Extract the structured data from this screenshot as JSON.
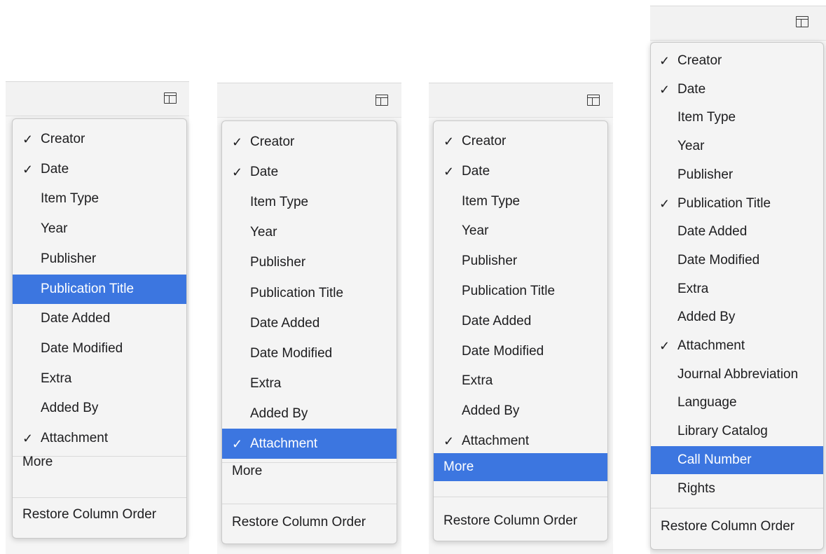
{
  "check_mark": "✓",
  "colors": {
    "highlight": "#3c76e0",
    "menu_bg": "#f4f4f4",
    "header_bg": "#f2f2f2"
  },
  "icons": {
    "column_picker": "column-picker-icon"
  },
  "menus": [
    {
      "items": [
        {
          "label": "Creator",
          "checked": true
        },
        {
          "label": "Date",
          "checked": true
        },
        {
          "label": "Item Type",
          "checked": false
        },
        {
          "label": "Year",
          "checked": false
        },
        {
          "label": "Publisher",
          "checked": false
        },
        {
          "label": "Publication Title",
          "checked": false,
          "highlighted": true
        },
        {
          "label": "Date Added",
          "checked": false
        },
        {
          "label": "Date Modified",
          "checked": false
        },
        {
          "label": "Extra",
          "checked": false
        },
        {
          "label": "Added By",
          "checked": false
        },
        {
          "label": "Attachment",
          "checked": true
        }
      ],
      "more_label": "More",
      "restore_label": "Restore Column Order"
    },
    {
      "items": [
        {
          "label": "Creator",
          "checked": true
        },
        {
          "label": "Date",
          "checked": true
        },
        {
          "label": "Item Type",
          "checked": false
        },
        {
          "label": "Year",
          "checked": false
        },
        {
          "label": "Publisher",
          "checked": false
        },
        {
          "label": "Publication Title",
          "checked": false
        },
        {
          "label": "Date Added",
          "checked": false
        },
        {
          "label": "Date Modified",
          "checked": false
        },
        {
          "label": "Extra",
          "checked": false
        },
        {
          "label": "Added By",
          "checked": false
        },
        {
          "label": "Attachment",
          "checked": true,
          "highlighted": true
        }
      ],
      "more_label": "More",
      "restore_label": "Restore Column Order"
    },
    {
      "items": [
        {
          "label": "Creator",
          "checked": true
        },
        {
          "label": "Date",
          "checked": true
        },
        {
          "label": "Item Type",
          "checked": false
        },
        {
          "label": "Year",
          "checked": false
        },
        {
          "label": "Publisher",
          "checked": false
        },
        {
          "label": "Publication Title",
          "checked": false
        },
        {
          "label": "Date Added",
          "checked": false
        },
        {
          "label": "Date Modified",
          "checked": false
        },
        {
          "label": "Extra",
          "checked": false
        },
        {
          "label": "Added By",
          "checked": false
        },
        {
          "label": "Attachment",
          "checked": true
        }
      ],
      "more_label": "More",
      "more_highlighted": true,
      "restore_label": "Restore Column Order"
    },
    {
      "items": [
        {
          "label": "Creator",
          "checked": true
        },
        {
          "label": "Date",
          "checked": true
        },
        {
          "label": "Item Type",
          "checked": false
        },
        {
          "label": "Year",
          "checked": false
        },
        {
          "label": "Publisher",
          "checked": false
        },
        {
          "label": "Publication Title",
          "checked": true
        },
        {
          "label": "Date Added",
          "checked": false
        },
        {
          "label": "Date Modified",
          "checked": false
        },
        {
          "label": "Extra",
          "checked": false
        },
        {
          "label": "Added By",
          "checked": false
        },
        {
          "label": "Attachment",
          "checked": true
        },
        {
          "label": "Journal Abbreviation",
          "checked": false
        },
        {
          "label": "Language",
          "checked": false
        },
        {
          "label": "Library Catalog",
          "checked": false
        },
        {
          "label": "Call Number",
          "checked": false,
          "highlighted": true
        },
        {
          "label": "Rights",
          "checked": false
        }
      ],
      "restore_label": "Restore Column Order"
    }
  ]
}
